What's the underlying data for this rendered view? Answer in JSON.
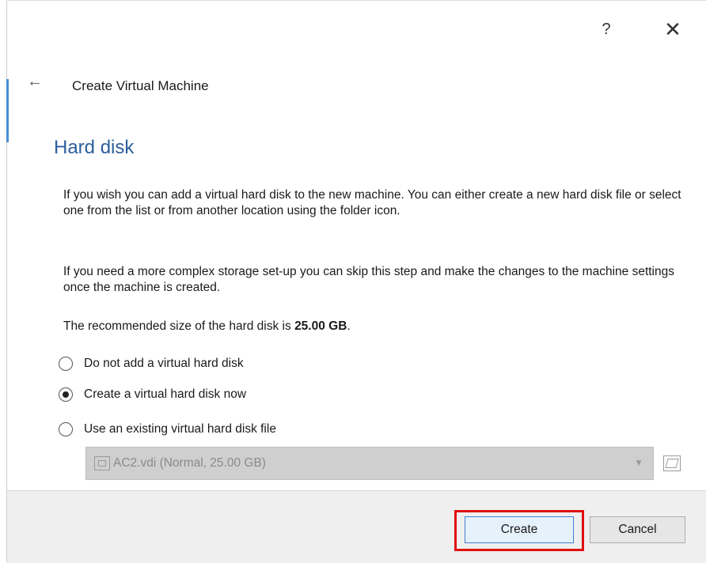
{
  "window": {
    "help_label": "?",
    "close_label": "✕"
  },
  "wizard": {
    "back_label": "←",
    "title": "Create Virtual Machine",
    "section_title": "Hard disk",
    "paragraph1": "If you wish you can add a virtual hard disk to the new machine. You can either create a new hard disk file or select one from the list or from another location using the folder icon.",
    "paragraph2": "If you need a more complex storage set-up you can skip this step and make the changes to the machine settings once the machine is created.",
    "recommended_prefix": "The recommended size of the hard disk is ",
    "recommended_size": "25.00 GB",
    "recommended_suffix": "."
  },
  "options": [
    {
      "label": "Do not add a virtual hard disk",
      "checked": false
    },
    {
      "label": "Create a virtual hard disk now",
      "checked": true
    },
    {
      "label": "Use an existing virtual hard disk file",
      "checked": false
    }
  ],
  "disk_combo": {
    "value": "AC2.vdi (Normal, 25.00 GB)",
    "enabled": false
  },
  "buttons": {
    "create": "Create",
    "cancel": "Cancel"
  },
  "colors": {
    "section_title": "#2c5f9e",
    "highlight_box": "#e01010",
    "default_button_border": "#3f7fd6"
  }
}
